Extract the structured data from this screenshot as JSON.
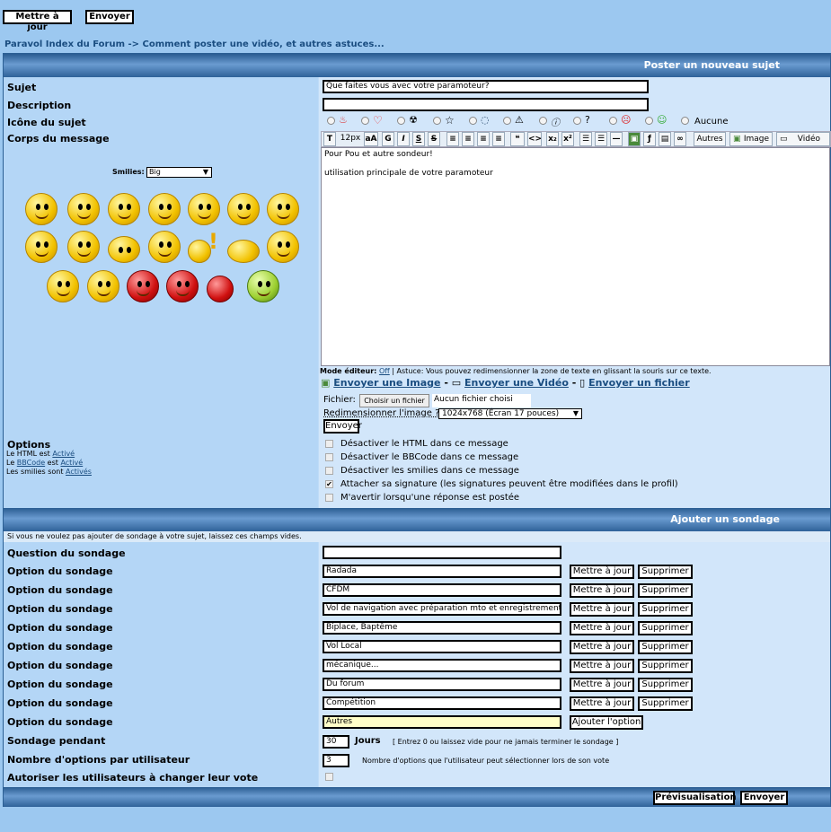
{
  "top_buttons": {
    "update": "Mettre à jour",
    "send": "Envoyer"
  },
  "breadcrumb": {
    "forum": "Paravol Index du Forum",
    "sep": "->",
    "topic": "Comment poster une vidéo, et autres astuces..."
  },
  "post_section": {
    "header": "Poster un nouveau sujet",
    "subject_label": "Sujet",
    "subject_value": "Que faites vous avec votre paramoteur?",
    "description_label": "Description",
    "description_value": "",
    "icon_label": "Icône du sujet",
    "icon_none_label": "Aucune",
    "body_label": "Corps du message",
    "smilies_label": "Smilies:",
    "smilies_select": "Big",
    "toolbar": {
      "size": "12px",
      "others": "Autres",
      "image": "Image",
      "video": "Vidéo"
    },
    "message_line1": "Pour Pou et autre sondeur!",
    "message_line2": "utilisation principale de votre paramoteur",
    "editor_mode_label": "Mode éditeur:",
    "editor_mode_value": "Off",
    "editor_tip": "| Astuce: Vous pouvez redimensionner la zone de texte en glissant la souris sur ce texte.",
    "upload_image": "Envoyer une Image",
    "upload_video": "Envoyer une Vidéo",
    "upload_file": "Envoyer un fichier",
    "dash": "-",
    "file_label": "Fichier:",
    "file_button": "Choisir un fichier",
    "file_none": "Aucun fichier choisi",
    "resize_label": "Redimensionner l'image ?",
    "resize_value": "1024x768 (Écran 17 pouces)",
    "send_button": "Envoyer"
  },
  "options": {
    "title": "Options",
    "html": {
      "prefix": "Le HTML est",
      "value": "Activé"
    },
    "bbcode": {
      "prefix": "Le",
      "link": "BBCode",
      "mid": "est",
      "value": "Activé"
    },
    "smilies": {
      "prefix": "Les smilies sont",
      "value": "Activés"
    },
    "checks": [
      {
        "label": "Désactiver le HTML dans ce message",
        "checked": false
      },
      {
        "label": "Désactiver le BBCode dans ce message",
        "checked": false
      },
      {
        "label": "Désactiver les smilies dans ce message",
        "checked": false
      },
      {
        "label": "Attacher sa signature (les signatures peuvent être modifiées dans le profil)",
        "checked": true
      },
      {
        "label": "M'avertir lorsqu'une réponse est postée",
        "checked": false
      }
    ]
  },
  "poll": {
    "header": "Ajouter un sondage",
    "hint": "Si vous ne voulez pas ajouter de sondage à votre sujet, laissez ces champs vides.",
    "question_label": "Question du sondage",
    "question_value": "",
    "option_label": "Option du sondage",
    "update_button": "Mettre à jour",
    "delete_button": "Supprimer",
    "add_button": "Ajouter l'option",
    "options": [
      "Radada",
      "CFDM",
      "Vol de navigation avec préparation mto et enregistrement",
      "Biplace, Baptême",
      "Vol Local",
      "mécanique...",
      "Du forum",
      "Compétition"
    ],
    "new_option": "Autres",
    "duration_label": "Sondage pendant",
    "duration_value": "30",
    "duration_unit": "Jours",
    "duration_hint": "[ Entrez 0 ou laissez vide pour ne jamais terminer le sondage ]",
    "max_options_label": "Nombre d'options par utilisateur",
    "max_options_value": "3",
    "max_options_hint": "Nombre d'options que l'utilisateur peut sélectionner lors de son vote",
    "change_vote_label": "Autoriser les utilisateurs à changer leur vote"
  },
  "footer": {
    "preview": "Prévisualisation",
    "send": "Envoyer"
  }
}
